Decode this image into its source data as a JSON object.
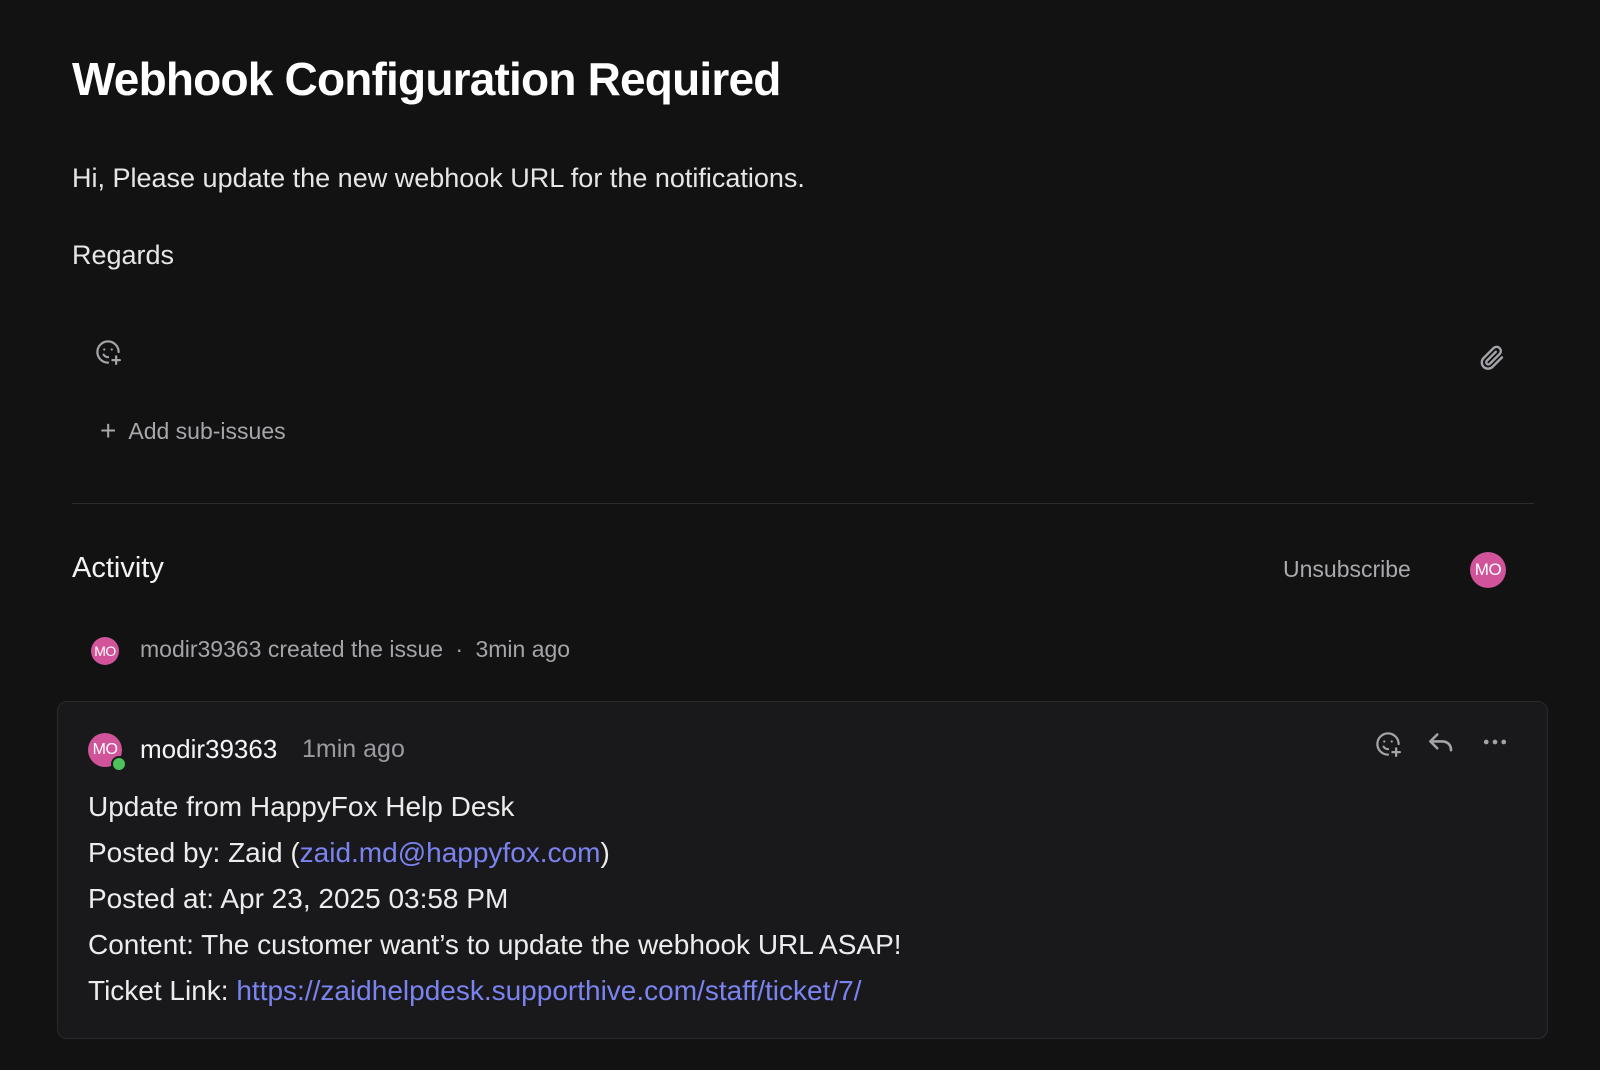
{
  "issue": {
    "title": "Webhook Configuration Required",
    "description_lines": [
      "Hi, Please update the new webhook URL for the notifications.",
      "Regards"
    ]
  },
  "toolbar": {
    "add_reaction_icon": "emoji-add-icon",
    "attach_icon": "paperclip-icon",
    "add_sub_issues_label": "Add sub-issues"
  },
  "activity": {
    "heading": "Activity",
    "unsubscribe_label": "Unsubscribe",
    "subscriber_initials": "MO",
    "events": [
      {
        "initials": "MO",
        "user": "modir39363",
        "action": "created the issue",
        "separator": "·",
        "time": "3min ago"
      }
    ]
  },
  "comment": {
    "initials": "MO",
    "author": "modir39363",
    "time": "1min ago",
    "online_color": "#4cc35a",
    "line1": "Update from HappyFox Help Desk",
    "posted_by_prefix": "Posted by: Zaid (",
    "posted_by_email": "zaid.md@happyfox.com",
    "posted_by_suffix": ")",
    "posted_at": "Posted at: Apr 23, 2025 03:58 PM",
    "content": "Content: The customer want’s to update the webhook URL ASAP!",
    "ticket_prefix": "Ticket Link: ",
    "ticket_url": "https://zaidhelpdesk.supporthive.com/staff/ticket/7/",
    "actions": [
      "emoji-add-icon",
      "reply-icon",
      "more-icon"
    ]
  },
  "colors": {
    "background": "#121213",
    "card": "#19191b",
    "avatar": "#d1539a",
    "link": "#7b83f0"
  }
}
